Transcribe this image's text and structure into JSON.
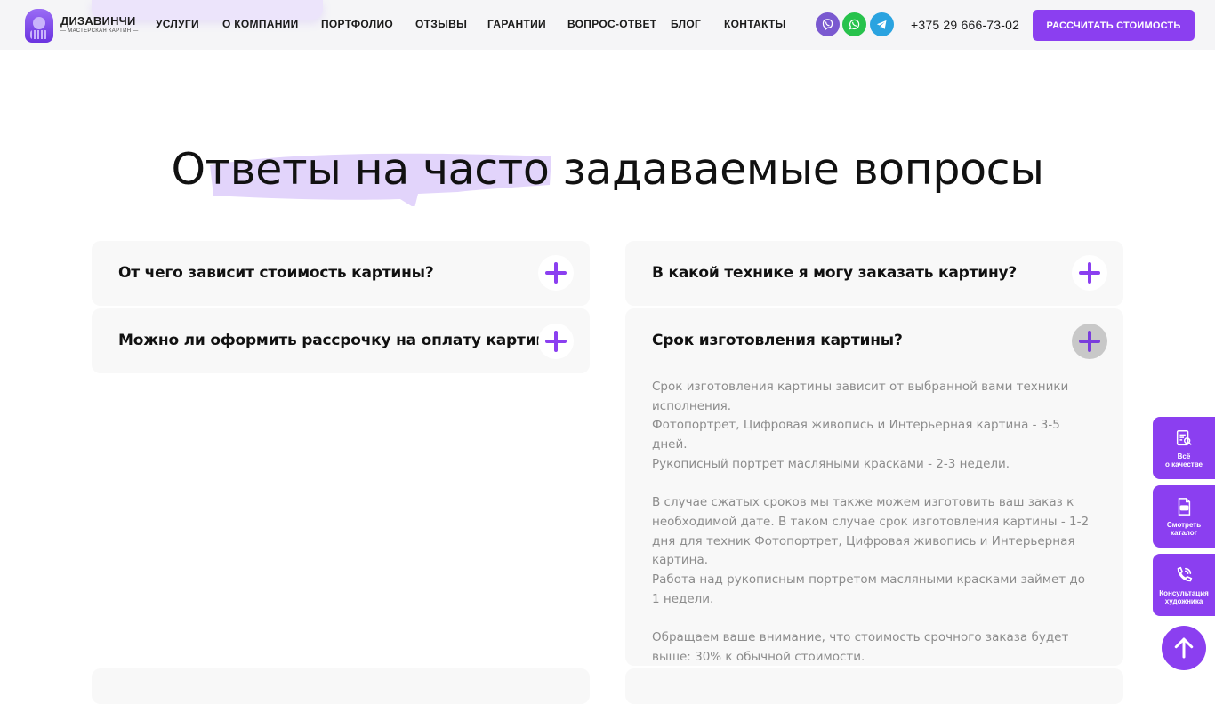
{
  "brand": {
    "name": "ДИЗАВИНЧИ",
    "tagline": "— МАСТЕРСКАЯ КАРТИН —"
  },
  "nav": {
    "items": [
      {
        "label": "УСЛУГИ"
      },
      {
        "label": "О КОМПАНИИ"
      },
      {
        "label": "ПОРТФОЛИО"
      },
      {
        "label": "ОТЗЫВЫ"
      },
      {
        "label": "ГАРАНТИИ"
      },
      {
        "label": "ВОПРОС-ОТВЕТ"
      },
      {
        "label": "БЛОГ"
      },
      {
        "label": "КОНТАКТЫ"
      }
    ]
  },
  "social": [
    {
      "icon": "viber-icon",
      "color": "#7a59d0"
    },
    {
      "icon": "whatsapp-icon",
      "color": "#27c24c"
    },
    {
      "icon": "telegram-icon",
      "color": "#2aa3e0"
    }
  ],
  "contact": {
    "phone": "+375 29 666-73-02",
    "cta_label": "РАССЧИТАТЬ СТОИМОСТЬ"
  },
  "faq": {
    "title": "Ответы на часто задаваемые вопросы",
    "left": [
      {
        "question": "От чего зависит стоимость картины?",
        "open": false
      },
      {
        "question": "Можно ли оформить рассрочку на оплату картины?",
        "open": false
      }
    ],
    "right": [
      {
        "question": "В какой технике я могу заказать картину?",
        "open": false
      },
      {
        "question": "Срок изготовления картины?",
        "open": true,
        "answer": [
          "Срок изготовления картины зависит от выбранной вами техники исполнения.",
          "Фотопортрет, Цифровая живопись и Интерьерная картина - 3-5 дней.",
          "Рукописный портрет масляными красками - 2-3 недели.",
          "",
          "В случае сжатых сроков мы также можем изготовить ваш заказ к необходимой дате. В таком случае срок изготовления картины - 1-2 дня для техник Фотопортрет, Цифровая живопись и Интерьерная картина.",
          "Работа над рукописным портретом масляными красками займет до 1 недели.",
          "",
          "Обращаем ваше внимание, что стоимость срочного заказа будет выше: 30% к обычной стоимости."
        ]
      }
    ]
  },
  "side_buttons": [
    {
      "label": "Всё\nо качестве",
      "icon": "quality-doc-icon"
    },
    {
      "label": "Смотреть\nкаталог",
      "icon": "pdf-catalog-icon"
    },
    {
      "label": "Консультация\nхудожника",
      "icon": "phone-call-icon"
    }
  ],
  "colors": {
    "accent": "#8b3ff0",
    "header_bg": "#f5f5f7",
    "card_bg": "#f8f8f8",
    "answer_text": "#8c8c8c",
    "highlight": "#e2d4fb"
  }
}
